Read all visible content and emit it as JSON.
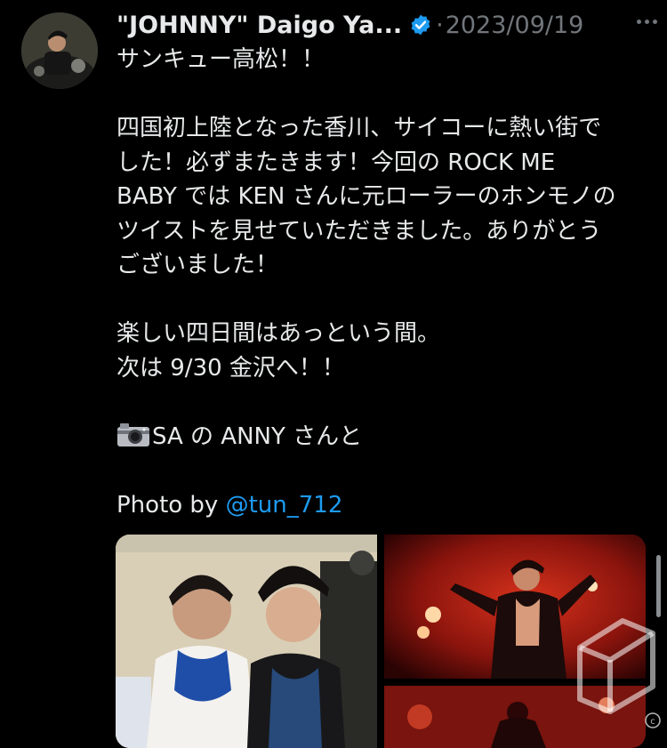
{
  "author": {
    "display_name": "\"JOHNNY\" Daigo Ya...",
    "verified_icon": "verified-badge-icon"
  },
  "separator": "·",
  "timestamp": "2023/09/19",
  "tweet": {
    "line1": "サンキュー高松！！",
    "para2": [
      "四国初上陸となった香川、サイコーに熱い街で",
      "した！必ずまたきます！今回の ROCK ME",
      "BABY では KEN さんに元ローラーのホンモノの",
      "ツイストを見せていただきました。ありがとう",
      "ございました！"
    ],
    "para3": [
      "楽しい四日間はあっという間。",
      "次は 9/30 金沢へ！！"
    ],
    "camera_text": "SA の ANNY さんと",
    "photo_by_prefix": "Photo by ",
    "photo_by_mention": "@tun_712"
  },
  "media": {
    "count": 3
  },
  "colors": {
    "background": "#000000",
    "text": "#e7e9ea",
    "secondary": "#71767b",
    "link": "#1d9bf0"
  }
}
